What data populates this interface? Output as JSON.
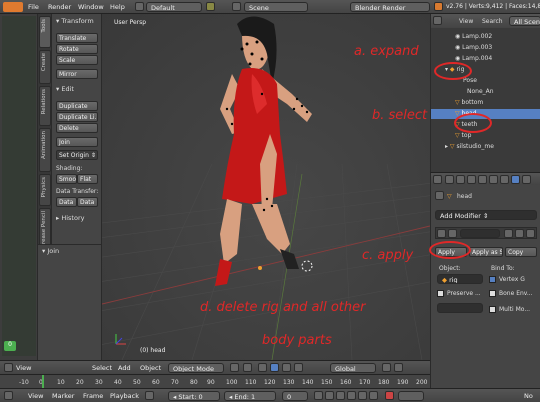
{
  "topbar": {
    "menus": [
      "File",
      "Render",
      "Window",
      "Help"
    ],
    "layout": "Default",
    "scene": "Scene",
    "engine": "Blender Render",
    "stats": "v2.76 | Verts:9,412 | Faces:14,834 | Tri"
  },
  "left_tabs": [
    "Tools",
    "Create",
    "Relations",
    "Animation",
    "Physics",
    "Grease Pencil"
  ],
  "tool_panel": {
    "transform_header": "Transform",
    "transform_buttons": [
      "Translate",
      "Rotate",
      "Scale",
      "Mirror"
    ],
    "edit_header": "Edit",
    "edit_buttons": [
      "Duplicate",
      "Duplicate Li...",
      "Delete",
      "Join"
    ],
    "set_origin": "Set Origin",
    "shading_label": "Shading:",
    "smooth": "Smoo",
    "flat": "Flat",
    "data_transfer_label": "Data Transfer:",
    "data1": "Data",
    "data2": "Data",
    "history_header": "History",
    "join_header": "Join"
  },
  "viewport": {
    "label": "User Persp",
    "object_label": "(0) head"
  },
  "left_strip": {
    "badge": "0"
  },
  "viewport_header": {
    "view": "View",
    "select": "Select",
    "add": "Add",
    "object": "Object",
    "mode": "Object Mode",
    "orientation": "Global"
  },
  "timeline": {
    "ticks": [
      "-10",
      "0",
      "10",
      "20",
      "30",
      "40",
      "50",
      "60",
      "70",
      "80",
      "90",
      "100",
      "110",
      "120",
      "130",
      "140",
      "150",
      "160",
      "170",
      "180",
      "190",
      "200",
      "210",
      "220",
      "230",
      "240",
      "250"
    ]
  },
  "timeline_header": {
    "view": "View",
    "marker": "Marker",
    "frame": "Frame",
    "playback": "Playback",
    "start": "Start:",
    "start_val": "0",
    "end": "End:",
    "end_val": "1",
    "current": "0",
    "no": "No"
  },
  "outliner": {
    "view": "View",
    "search": "Search",
    "all_scenes": "All Scenes",
    "rows": [
      "Lamp.002",
      "Lamp.003",
      "Lamp.004",
      "rig",
      "Pose",
      "None_An",
      "bottom",
      "head",
      "teeth",
      "top",
      "silstudio_me"
    ]
  },
  "properties": {
    "object_name": "head",
    "add_modifier": "Add Modifier",
    "apply": "Apply",
    "apply_as": "Apply as S",
    "copy": "Copy",
    "object_label": "Object:",
    "bind_to_label": "Bind To:",
    "object_value": "rig",
    "vertex_group": "Vertex G",
    "preserve": "Preserve ...",
    "bone_env": "Bone Env...",
    "multi_mod": "Multi Mo..."
  },
  "annotations": {
    "a": "a. expand",
    "b": "b. select",
    "c": "c. apply",
    "d1": "d. delete rig and all other",
    "d2": "body parts"
  },
  "colors": {
    "accent": "#e02828",
    "selected": "#5680c2",
    "orange": "#f0a030"
  }
}
